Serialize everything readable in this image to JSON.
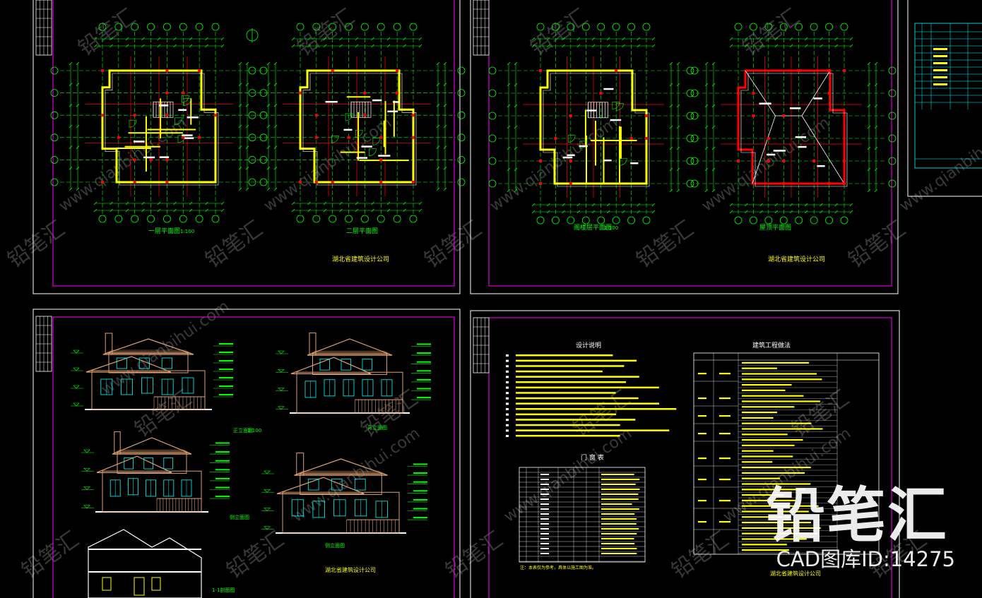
{
  "watermark": {
    "brand": "铅笔汇",
    "id_line": "CAD图库ID:14275",
    "tile_text": "铅笔汇",
    "url_text": "www.qianbihui.com"
  },
  "colors": {
    "background": "#000000",
    "frame": "#ff00ff",
    "sheet_border": "#ffffff",
    "grid": "#00ff00",
    "wall": "#ffff00",
    "axis_red": "#ff0000",
    "text_yellow": "#ffff00",
    "elevation": "#e0a070",
    "cyan": "#00ffff"
  },
  "sheets": [
    {
      "id": "plans-1",
      "captions": [
        "一层平面图",
        "二层平面图"
      ],
      "scale": "1:100",
      "company": "湖北省建筑设计公司",
      "axis_top": [
        "1",
        "2",
        "3",
        "4",
        "5",
        "6",
        "7",
        "8"
      ],
      "axis_side": [
        "A",
        "B",
        "C",
        "D",
        "E",
        "F"
      ]
    },
    {
      "id": "plans-2",
      "captions": [
        "阁楼层平面图",
        "屋顶平面图"
      ],
      "scale": "1:100",
      "company": "湖北省建筑设计公司",
      "axis_top": [
        "1",
        "2",
        "3",
        "4",
        "5",
        "6"
      ],
      "axis_side": [
        "A",
        "B",
        "C",
        "D",
        "E",
        "F"
      ]
    },
    {
      "id": "elevations",
      "captions": [
        "正立面图",
        "背立面图",
        "侧立面图",
        "侧立面图",
        "1-1剖面图"
      ],
      "scale": "1:100",
      "company": "湖北省建筑设计公司"
    },
    {
      "id": "notes",
      "design_notes_title": "设计说明",
      "door_table_title": "门 窗 表",
      "method_table_title": "建筑工程做法",
      "footnote": "注：本表仅为参考，具体以施工图为准。",
      "company": "湖北省建筑设计公司"
    }
  ]
}
